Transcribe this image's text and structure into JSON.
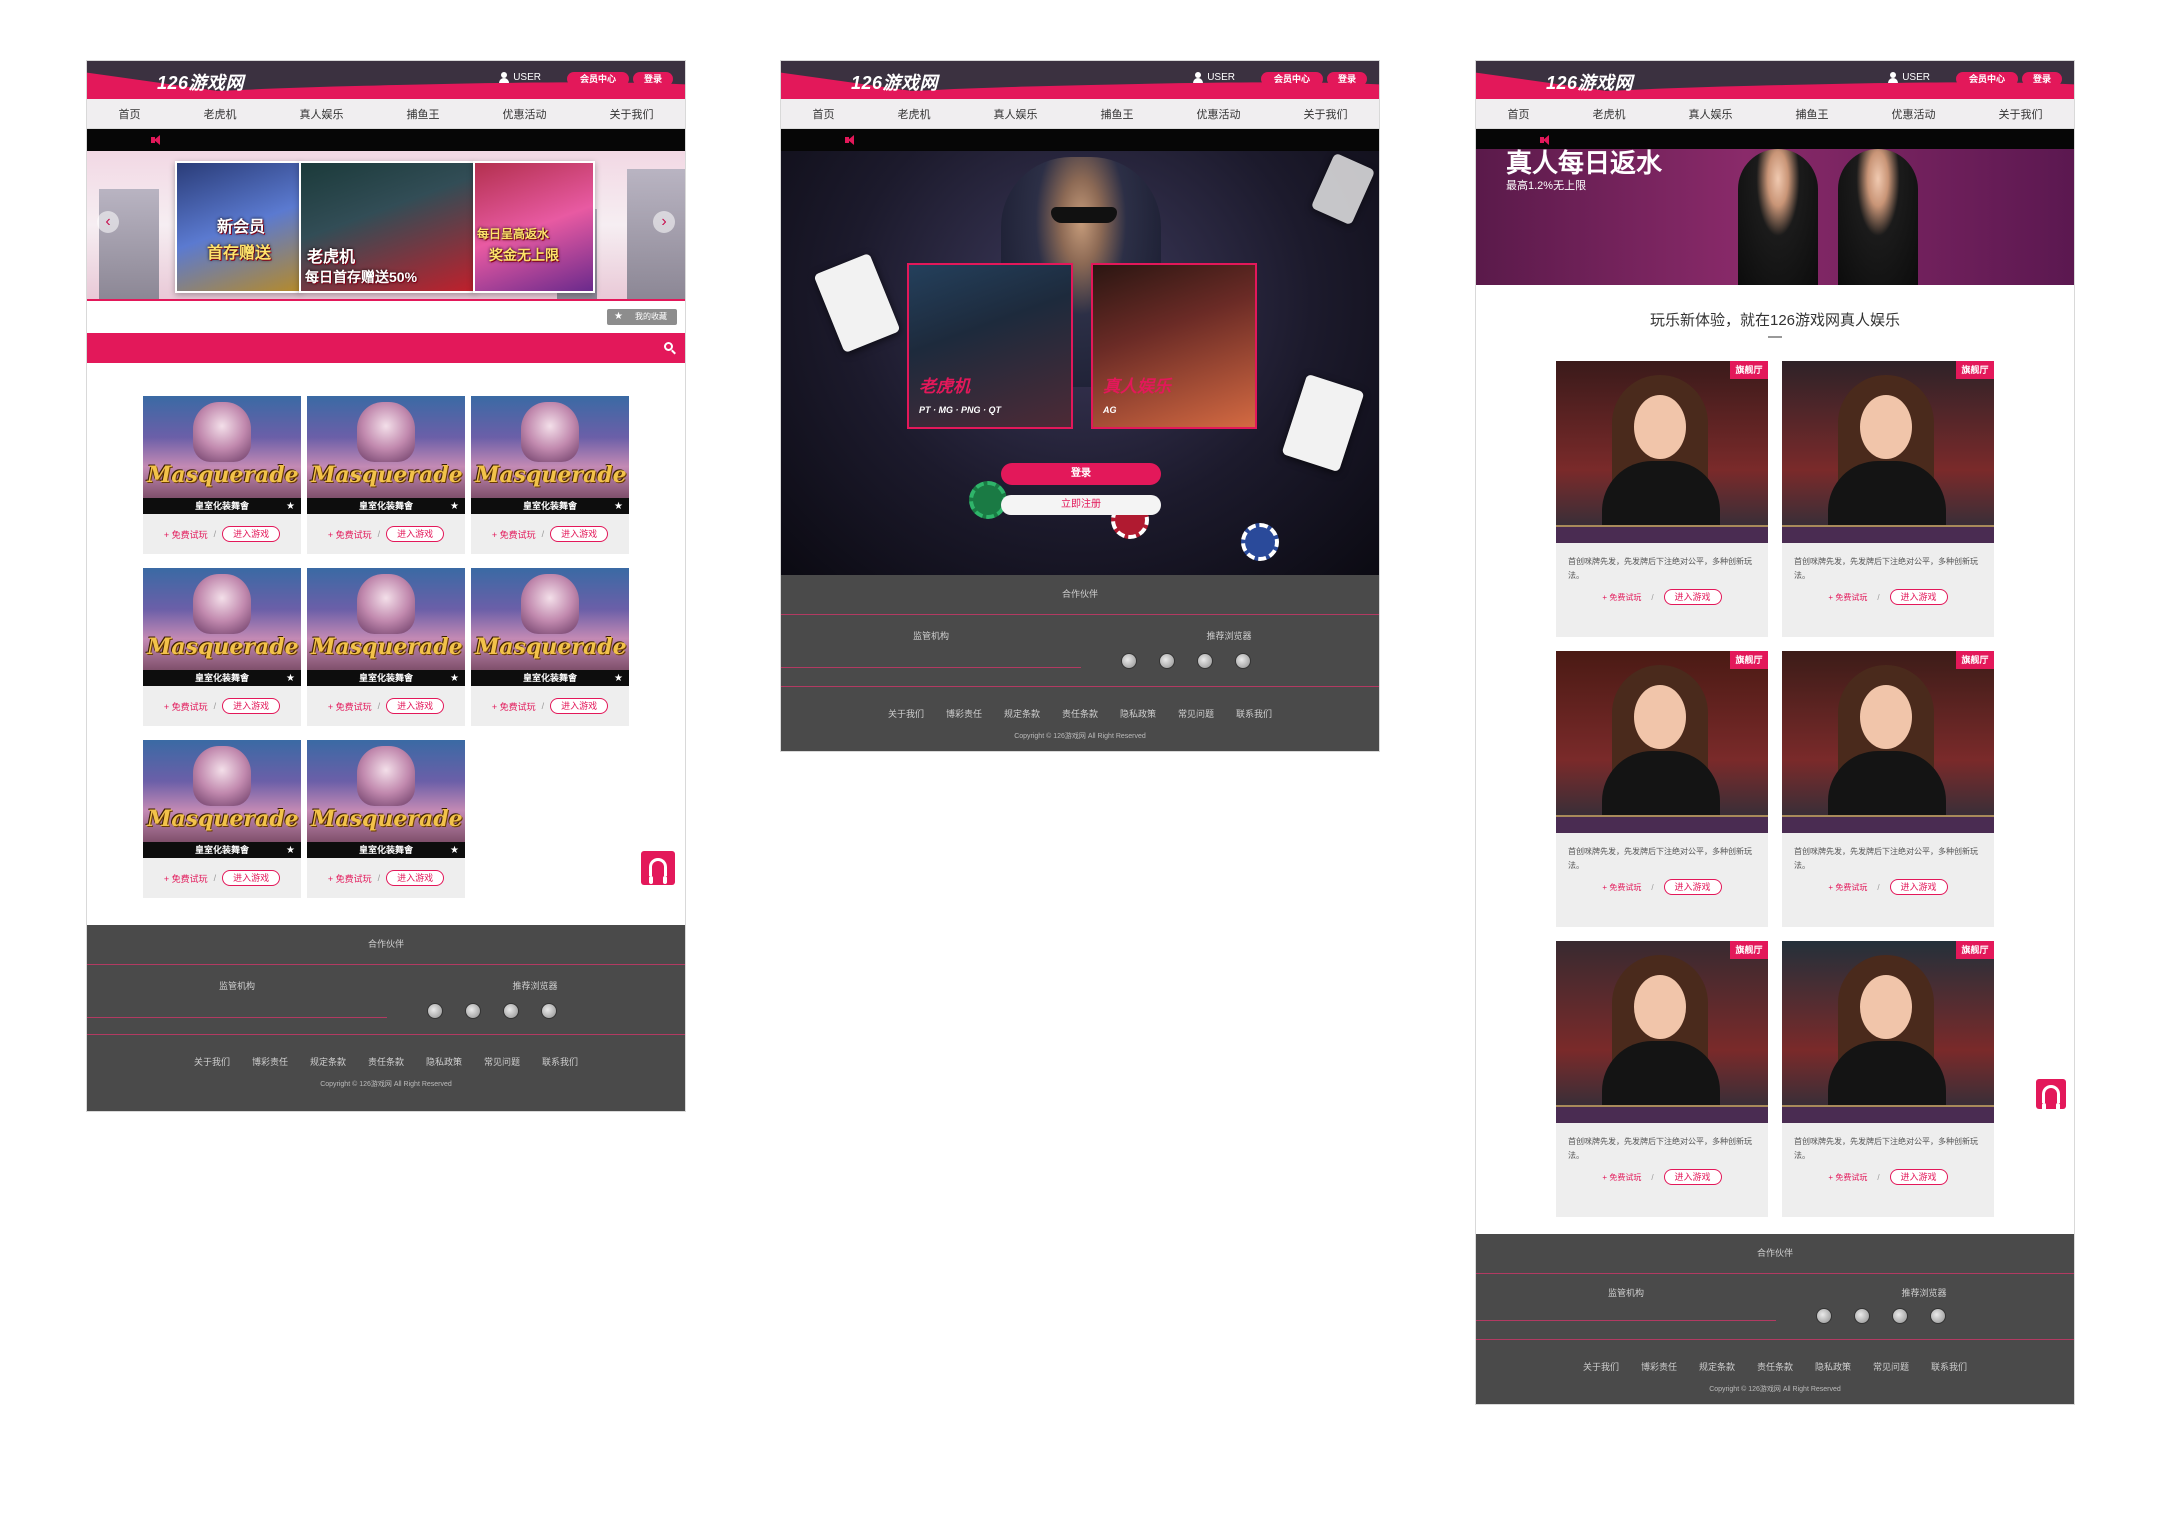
{
  "site": {
    "logo": "126游戏网",
    "user_label": "USER",
    "member_center": "会员中心",
    "login": "登录"
  },
  "nav": [
    "首页",
    "老虎机",
    "真人娱乐",
    "捕鱼王",
    "优惠活动",
    "关于我们"
  ],
  "page1": {
    "banner": {
      "new_member": "新会员",
      "first_deposit": "首存赠送",
      "slots": "老虎机",
      "daily_bonus": "每日首存赠送50%",
      "daily_rebate": "每日呈高返水",
      "unlimited": "奖金无上限"
    },
    "favorites": "我的收藏",
    "games": [
      {
        "title": "Masquerade",
        "name": "皇室化装舞會"
      },
      {
        "title": "Masquerade",
        "name": "皇室化装舞會"
      },
      {
        "title": "Masquerade",
        "name": "皇室化装舞會"
      },
      {
        "title": "Masquerade",
        "name": "皇室化装舞會"
      },
      {
        "title": "Masquerade",
        "name": "皇室化装舞會"
      },
      {
        "title": "Masquerade",
        "name": "皇室化装舞會"
      },
      {
        "title": "Masquerade",
        "name": "皇室化装舞會"
      },
      {
        "title": "Masquerade",
        "name": "皇室化装舞會"
      }
    ],
    "free_trial": "+ 免费试玩",
    "separator": "/",
    "enter_game": "进入游戏"
  },
  "page2": {
    "slot_tile": {
      "title": "老虎机",
      "providers": "PT · MG · PNG · QT"
    },
    "live_tile": {
      "title": "真人娱乐",
      "providers": "AG"
    },
    "login": "登录",
    "register": "立即注册"
  },
  "page3": {
    "banner_title": "真人每日返水",
    "banner_sub": "最高1.2%无上限",
    "heading": "玩乐新体验，就在126游戏网真人娱乐",
    "flag": "旗舰厅",
    "desc": "首创咪牌先发，先发牌后下注绝对公平，多种创新玩法。",
    "free_trial": "+ 免费试玩",
    "separator": "/",
    "enter_game": "进入游戏"
  },
  "footer": {
    "partners": "合作伙伴",
    "regulator": "监管机构",
    "browsers": "推荐浏览器",
    "links": [
      "关于我们",
      "博彩责任",
      "规定条款",
      "责任条款",
      "隐私政策",
      "常见问题",
      "联系我们"
    ],
    "copyright": "Copyright © 126游戏网 All Right Reserved"
  },
  "colors": {
    "brand": "#e3185a",
    "header": "#3b3140",
    "footer": "#4a4a4a"
  }
}
